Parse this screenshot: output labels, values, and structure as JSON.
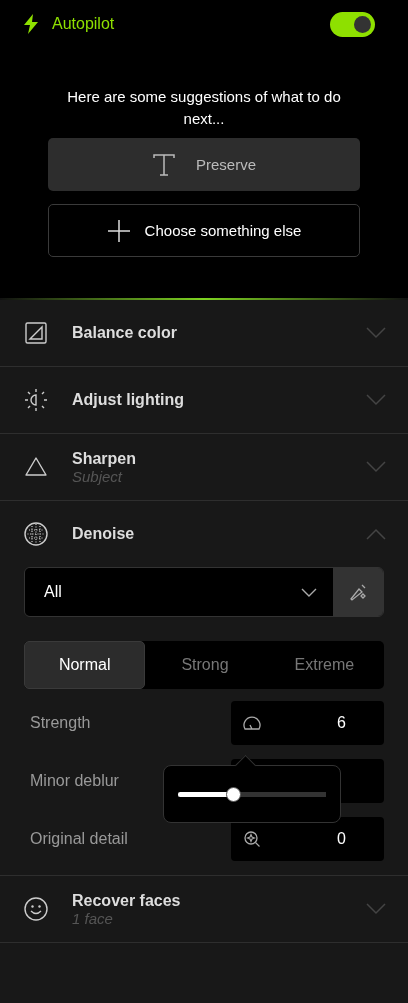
{
  "autopilot": {
    "title": "Autopilot",
    "on": true,
    "prompt": "Here are some suggestions of what to do next...",
    "suggestions": [
      {
        "label": "Preserve",
        "kind": "suggestion"
      },
      {
        "label": "Choose something else",
        "kind": "other"
      }
    ]
  },
  "sections": [
    {
      "title": "Balance color",
      "expanded": false
    },
    {
      "title": "Adjust lighting",
      "expanded": false
    },
    {
      "title": "Sharpen",
      "subtitle": "Subject",
      "expanded": false
    },
    {
      "title": "Denoise",
      "expanded": true,
      "dropdown": {
        "value": "All"
      },
      "modes": [
        {
          "label": "Normal",
          "selected": true
        },
        {
          "label": "Strong",
          "selected": false
        },
        {
          "label": "Extreme",
          "selected": false
        }
      ],
      "params": [
        {
          "label": "Strength",
          "value": "6"
        },
        {
          "label": "Minor deblur"
        },
        {
          "label": "Original detail",
          "value": "0"
        }
      ],
      "slider": {
        "level": 0.37
      }
    },
    {
      "title": "Recover faces",
      "subtitle": "1 face",
      "expanded": false
    }
  ]
}
